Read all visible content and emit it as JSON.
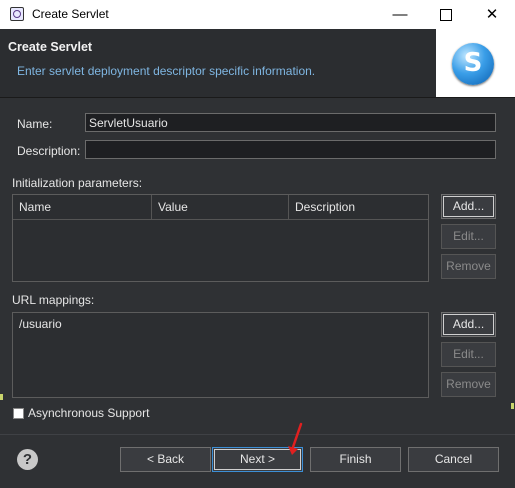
{
  "window": {
    "title": "Create Servlet",
    "minimize": "—",
    "close": "✕"
  },
  "banner": {
    "heading": "Create Servlet",
    "description": "Enter servlet deployment descriptor specific information.",
    "logo_letter": "S"
  },
  "form": {
    "name_label": "Name:",
    "name_value": "ServletUsuario",
    "description_label": "Description:",
    "description_value": ""
  },
  "init_params": {
    "label": "Initialization parameters:",
    "columns": [
      "Name",
      "Value",
      "Description"
    ],
    "buttons": {
      "add": "Add...",
      "edit": "Edit...",
      "remove": "Remove"
    }
  },
  "url_mappings": {
    "label": "URL mappings:",
    "items": [
      "/usuario"
    ],
    "buttons": {
      "add": "Add...",
      "edit": "Edit...",
      "remove": "Remove"
    }
  },
  "async": {
    "label": "Asynchronous Support",
    "checked": false
  },
  "footer": {
    "help_icon": "?",
    "back": "< Back",
    "next": "Next >",
    "finish": "Finish",
    "cancel": "Cancel"
  }
}
